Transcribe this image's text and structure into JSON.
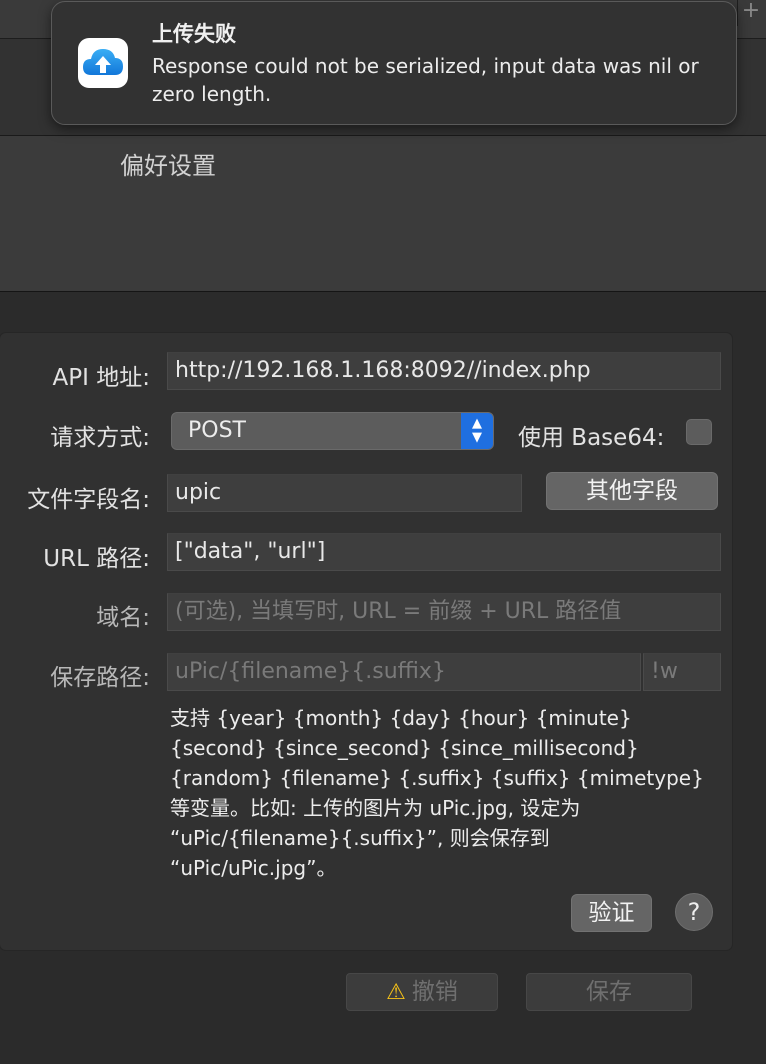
{
  "notification": {
    "title": "上传失败",
    "message": "Response could not be serialized, input data was nil or zero length.",
    "app_icon": "upic-cloud-upload-icon"
  },
  "window": {
    "title": "偏好设置",
    "plus_glyph": "+"
  },
  "form": {
    "api_label": "API 地址:",
    "api_value": "http://192.168.1.168:8092//index.php",
    "method_label": "请求方式:",
    "method_value": "POST",
    "base64_label": "使用 Base64:",
    "base64_checked": false,
    "file_field_label": "文件字段名:",
    "file_field_value": "upic",
    "other_fields_button": "其他字段",
    "url_path_label": "URL 路径:",
    "url_path_value": "[\"data\", \"url\"]",
    "domain_label": "域名:",
    "domain_placeholder": "(可选), 当填写时, URL = 前缀 + URL 路径值",
    "save_path_label": "保存路径:",
    "save_path_placeholder": "uPic/{filename}{.suffix}",
    "save_suffix_placeholder": "!w",
    "help_text": "支持 {year} {month} {day} {hour} {minute} {second} {since_second} {since_millisecond} {random} {filename} {.suffix} {suffix} {mimetype} 等变量。比如: 上传的图片为 uPic.jpg, 设定为 “uPic/{filename}{.suffix}”, 则会保存到 “uPic/uPic.jpg”。",
    "verify_button": "验证",
    "help_button": "?"
  },
  "footer": {
    "cancel_button": "撤销",
    "save_button": "保存",
    "warning_glyph": "⚠"
  },
  "colors": {
    "accent": "#1f6fe0",
    "warning": "#f6c218",
    "background": "#2b2b2b"
  }
}
